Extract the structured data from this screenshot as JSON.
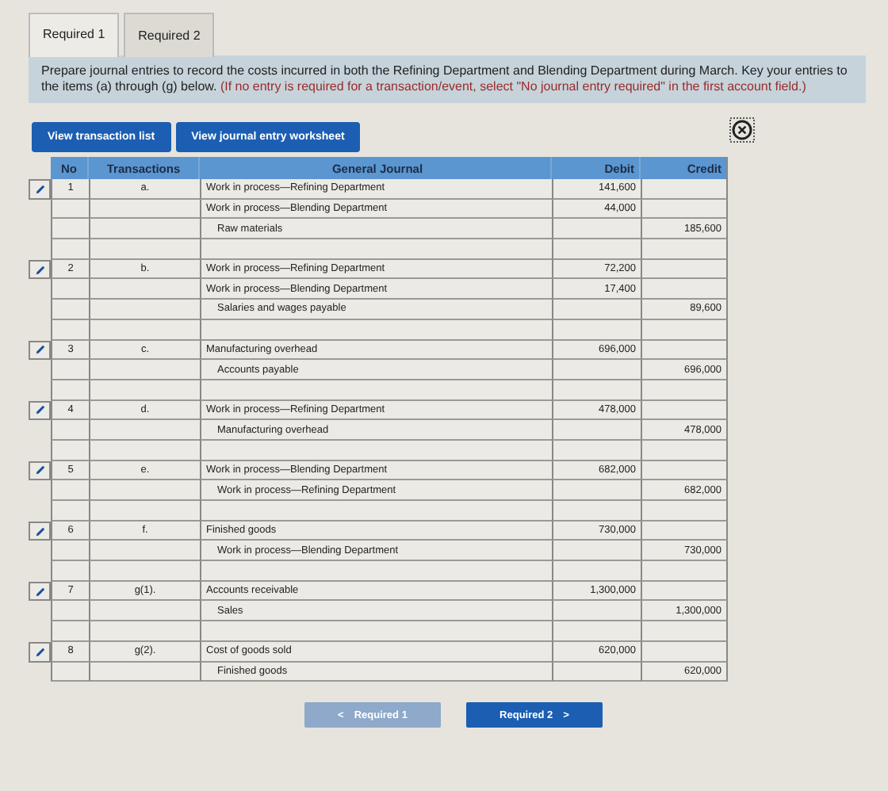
{
  "tabs": [
    {
      "label": "Required 1",
      "selected": true
    },
    {
      "label": "Required 2",
      "selected": false
    }
  ],
  "instructions": {
    "text": "Prepare journal entries to record the costs incurred in both the Refining Department and Blending Department during March. Key your entries to the items (a) through (g) below.",
    "note": "(If no entry is required for a transaction/event, select \"No journal entry required\" in the first account field.)"
  },
  "view_buttons": [
    "View transaction list",
    "View journal entry worksheet"
  ],
  "table": {
    "columns": [
      "No",
      "Transactions",
      "General Journal",
      "Debit",
      "Credit"
    ],
    "entries": [
      {
        "no": "1",
        "transaction": "a.",
        "lines": [
          {
            "account": "Work in process—Refining Department",
            "debit": "141,600",
            "kind": "debit"
          },
          {
            "account": "Work in process—Blending Department",
            "debit": "44,000",
            "kind": "debit"
          },
          {
            "account": "Raw materials",
            "credit": "185,600",
            "kind": "credit"
          },
          {
            "kind": "blank"
          }
        ]
      },
      {
        "no": "2",
        "transaction": "b.",
        "lines": [
          {
            "account": "Work in process—Refining Department",
            "debit": "72,200",
            "kind": "debit"
          },
          {
            "account": "Work in process—Blending Department",
            "debit": "17,400",
            "kind": "debit"
          },
          {
            "account": "Salaries and wages payable",
            "credit": "89,600",
            "kind": "credit"
          },
          {
            "kind": "blank"
          }
        ]
      },
      {
        "no": "3",
        "transaction": "c.",
        "lines": [
          {
            "account": "Manufacturing overhead",
            "debit": "696,000",
            "kind": "debit"
          },
          {
            "account": "Accounts payable",
            "credit": "696,000",
            "kind": "credit"
          },
          {
            "kind": "blank"
          }
        ]
      },
      {
        "no": "4",
        "transaction": "d.",
        "lines": [
          {
            "account": "Work in process—Refining Department",
            "debit": "478,000",
            "kind": "debit"
          },
          {
            "account": "Manufacturing overhead",
            "credit": "478,000",
            "kind": "credit"
          },
          {
            "kind": "blank"
          }
        ]
      },
      {
        "no": "5",
        "transaction": "e.",
        "lines": [
          {
            "account": "Work in process—Blending Department",
            "debit": "682,000",
            "kind": "debit"
          },
          {
            "account": "Work in process—Refining Department",
            "credit": "682,000",
            "kind": "credit"
          },
          {
            "kind": "blank"
          }
        ]
      },
      {
        "no": "6",
        "transaction": "f.",
        "lines": [
          {
            "account": "Finished goods",
            "debit": "730,000",
            "kind": "debit"
          },
          {
            "account": "Work in process—Blending Department",
            "credit": "730,000",
            "kind": "credit"
          },
          {
            "kind": "blank"
          }
        ]
      },
      {
        "no": "7",
        "transaction": "g(1).",
        "lines": [
          {
            "account": "Accounts receivable",
            "debit": "1,300,000",
            "kind": "debit"
          },
          {
            "account": "Sales",
            "credit": "1,300,000",
            "kind": "credit"
          },
          {
            "kind": "blank"
          }
        ]
      },
      {
        "no": "8",
        "transaction": "g(2).",
        "lines": [
          {
            "account": "Cost of goods sold",
            "debit": "620,000",
            "kind": "debit"
          },
          {
            "account": "Finished goods",
            "credit": "620,000",
            "kind": "credit"
          }
        ]
      }
    ]
  },
  "nav": [
    {
      "label": "Required 1",
      "chevron": "<",
      "kind": "prev",
      "disabled": true
    },
    {
      "label": "Required 2",
      "chevron": ">",
      "kind": "next",
      "disabled": false
    }
  ]
}
